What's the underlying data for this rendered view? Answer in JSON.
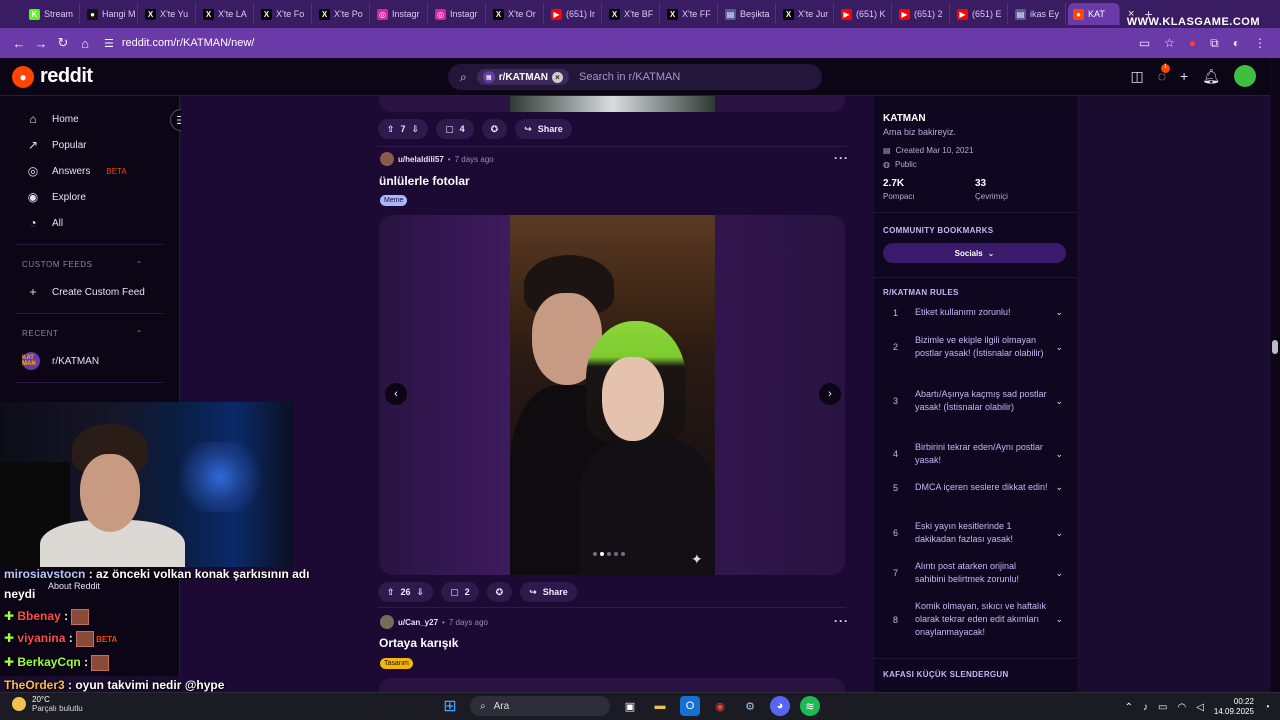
{
  "browser": {
    "tabs": [
      {
        "label": "Stream",
        "icon": "K",
        "color": "#53fc18"
      },
      {
        "label": "Hangi M",
        "icon": "●",
        "color": "#111111"
      },
      {
        "label": "X'te Yu",
        "icon": "X",
        "color": "#000000"
      },
      {
        "label": "X'te LA",
        "icon": "X",
        "color": "#000000"
      },
      {
        "label": "X'te Fo",
        "icon": "X",
        "color": "#000000"
      },
      {
        "label": "X'te Po",
        "icon": "X",
        "color": "#000000"
      },
      {
        "label": "Instagr",
        "icon": "◎",
        "color": "#d6249f"
      },
      {
        "label": "Instagr",
        "icon": "◎",
        "color": "#d6249f"
      },
      {
        "label": "X'te Or",
        "icon": "X",
        "color": "#000000"
      },
      {
        "label": "(651) Ir",
        "icon": "▶",
        "color": "#ff0000"
      },
      {
        "label": "X'te BF",
        "icon": "X",
        "color": "#000000"
      },
      {
        "label": "X'te FF",
        "icon": "X",
        "color": "#000000"
      },
      {
        "label": "Beşikta",
        "icon": "▤",
        "color": "#5a5a9a"
      },
      {
        "label": "X'te Jur",
        "icon": "X",
        "color": "#000000"
      },
      {
        "label": "(651) K",
        "icon": "▶",
        "color": "#ff0000"
      },
      {
        "label": "(651) 2",
        "icon": "▶",
        "color": "#ff0000"
      },
      {
        "label": "(651) E",
        "icon": "▶",
        "color": "#ff0000"
      },
      {
        "label": "ikas Ey",
        "icon": "▤",
        "color": "#5a5a9a"
      }
    ],
    "active_tab": {
      "label": "KAT",
      "icon": "●",
      "color": "#ff4500"
    },
    "url": "reddit.com/r/KATMAN/new/",
    "watermark": "WWW.KLASGAME.COM"
  },
  "reddit": {
    "logo_text": "reddit",
    "search_chip": "r/KATMAN",
    "search_placeholder": "Search in r/KATMAN",
    "notification_count": "1"
  },
  "left_nav": {
    "items": [
      {
        "label": "Home",
        "icon": "⌂"
      },
      {
        "label": "Popular",
        "icon": "↗"
      },
      {
        "label": "Answers",
        "icon": "◎",
        "badge": "BETA"
      },
      {
        "label": "Explore",
        "icon": "◉"
      },
      {
        "label": "All",
        "icon": "◔"
      }
    ],
    "custom_feeds_label": "CUSTOM FEEDS",
    "create_custom_feed": "Create Custom Feed",
    "recent_label": "RECENT",
    "recent_item": "r/KATMAN",
    "recent_icon_text": "KAT MAN"
  },
  "posts": [
    {
      "upvotes": "7",
      "comments": "4",
      "share": "Share"
    },
    {
      "user": "u/helaldili57",
      "time": "7 days ago",
      "title": "ünlülerle fotolar",
      "flair": "Meme",
      "flair_color": "#a8b8ff",
      "upvotes": "26",
      "comments": "2",
      "share": "Share",
      "gallery_count": 5,
      "gallery_index": 1
    },
    {
      "user": "u/Can_y27",
      "time": "7 days ago",
      "title": "Ortaya karışık",
      "flair": "Tasarım",
      "flair_color": "#f5b800"
    }
  ],
  "sidebar": {
    "name": "KATMAN",
    "description": "Ama biz bakireyiz.",
    "created": "Created Mar 10, 2021",
    "visibility": "Public",
    "members": "2.7K",
    "members_label": "Pompacı",
    "online": "33",
    "online_label": "Çevrimiçi",
    "bookmarks_title": "COMMUNITY BOOKMARKS",
    "socials_label": "Socials",
    "rules_title": "R/KATMAN RULES",
    "rules": [
      "Etiket kullanımı zorunlu!",
      "Bizimle ve ekiple ilgili olmayan postlar yasak! (İstisnalar olabilir)",
      "Abartı/Aşınya kaçmış sad postlar yasak! (İstisnalar olabilir)",
      "Birbirini tekrar eden/Aynı postlar yasak!",
      "DMCA içeren seslere dikkat edin!",
      "Eski yayın kesitlerinde 1 dakikadan fazlası yasak!",
      "Alıntı post atarken orijinal sahibini belirtmek zorunlu!",
      "Komik olmayan, sıkıcı ve haftalık olarak tekrar eden edit akımları onaylanmayacak!"
    ],
    "next_section": "KAFASI KÜÇÜK SLENDERGUN"
  },
  "overlay": {
    "chat": [
      {
        "name": "mirosiavstocn",
        "text": " : az önceki volkan konak şarkısının adı",
        "color": "#b9c6ff"
      },
      {
        "name": "",
        "text": "neydi",
        "color": "#ffffff"
      },
      {
        "name": "Bbenay",
        "text": " :",
        "color": "#ff4b4b"
      },
      {
        "name": "viyanina",
        "text": " :",
        "color": "#ff4b4b"
      },
      {
        "name": "BerkayCqn",
        "text": " :",
        "color": "#9dff3a"
      },
      {
        "name": "TheOrder3",
        "text": " : oyun takvimi nedir @hype",
        "color": "#ffb84d"
      }
    ],
    "behind_about": "About Reddit",
    "behind_beta": "BETA"
  },
  "taskbar": {
    "temp": "20°C",
    "weather": "Parçalı bulutlu",
    "search": "Ara",
    "time": "00:22",
    "date": "14.09.2025"
  }
}
